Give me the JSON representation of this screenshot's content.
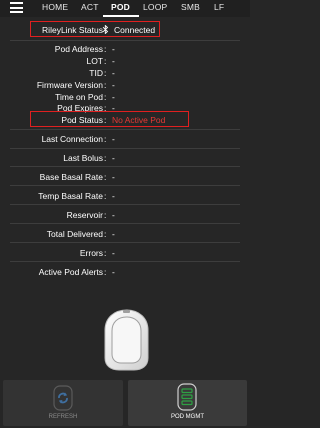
{
  "tabs": [
    {
      "label": "HOME"
    },
    {
      "label": "ACT"
    },
    {
      "label": "POD"
    },
    {
      "label": "LOOP"
    },
    {
      "label": "SMB"
    },
    {
      "label": "LF"
    }
  ],
  "rileylink": {
    "label": "RileyLink Status",
    "value": "Connected",
    "icon": "bluetooth-icon"
  },
  "info_rows": [
    {
      "label": "Pod Address",
      "value": "-"
    },
    {
      "label": "LOT",
      "value": "-"
    },
    {
      "label": "TID",
      "value": "-"
    },
    {
      "label": "Firmware Version",
      "value": "-"
    },
    {
      "label": "Time on Pod",
      "value": "-"
    },
    {
      "label": "Pod Expires",
      "value": "-"
    }
  ],
  "pod_status": {
    "label": "Pod Status",
    "value": "No Active Pod"
  },
  "detail_rows": [
    {
      "label": "Last Connection",
      "value": "-"
    },
    {
      "label": "Last Bolus",
      "value": "-"
    },
    {
      "label": "Base Basal Rate",
      "value": "-"
    },
    {
      "label": "Temp Basal Rate",
      "value": "-"
    },
    {
      "label": "Reservoir",
      "value": "-"
    },
    {
      "label": "Total Delivered",
      "value": "-"
    },
    {
      "label": "Errors",
      "value": "-"
    },
    {
      "label": "Active Pod Alerts",
      "value": "-"
    }
  ],
  "separator": ":",
  "buttons": {
    "refresh": {
      "label": "REFRESH",
      "icon": "refresh-icon"
    },
    "pod_mgmt": {
      "label": "POD MGMT",
      "icon": "pod-management-icon"
    }
  },
  "colors": {
    "background": "#262626",
    "alert_red": "#e53935",
    "refresh_icon": "#3f6fa0",
    "pod_mgmt_icon": "#2ea043"
  }
}
